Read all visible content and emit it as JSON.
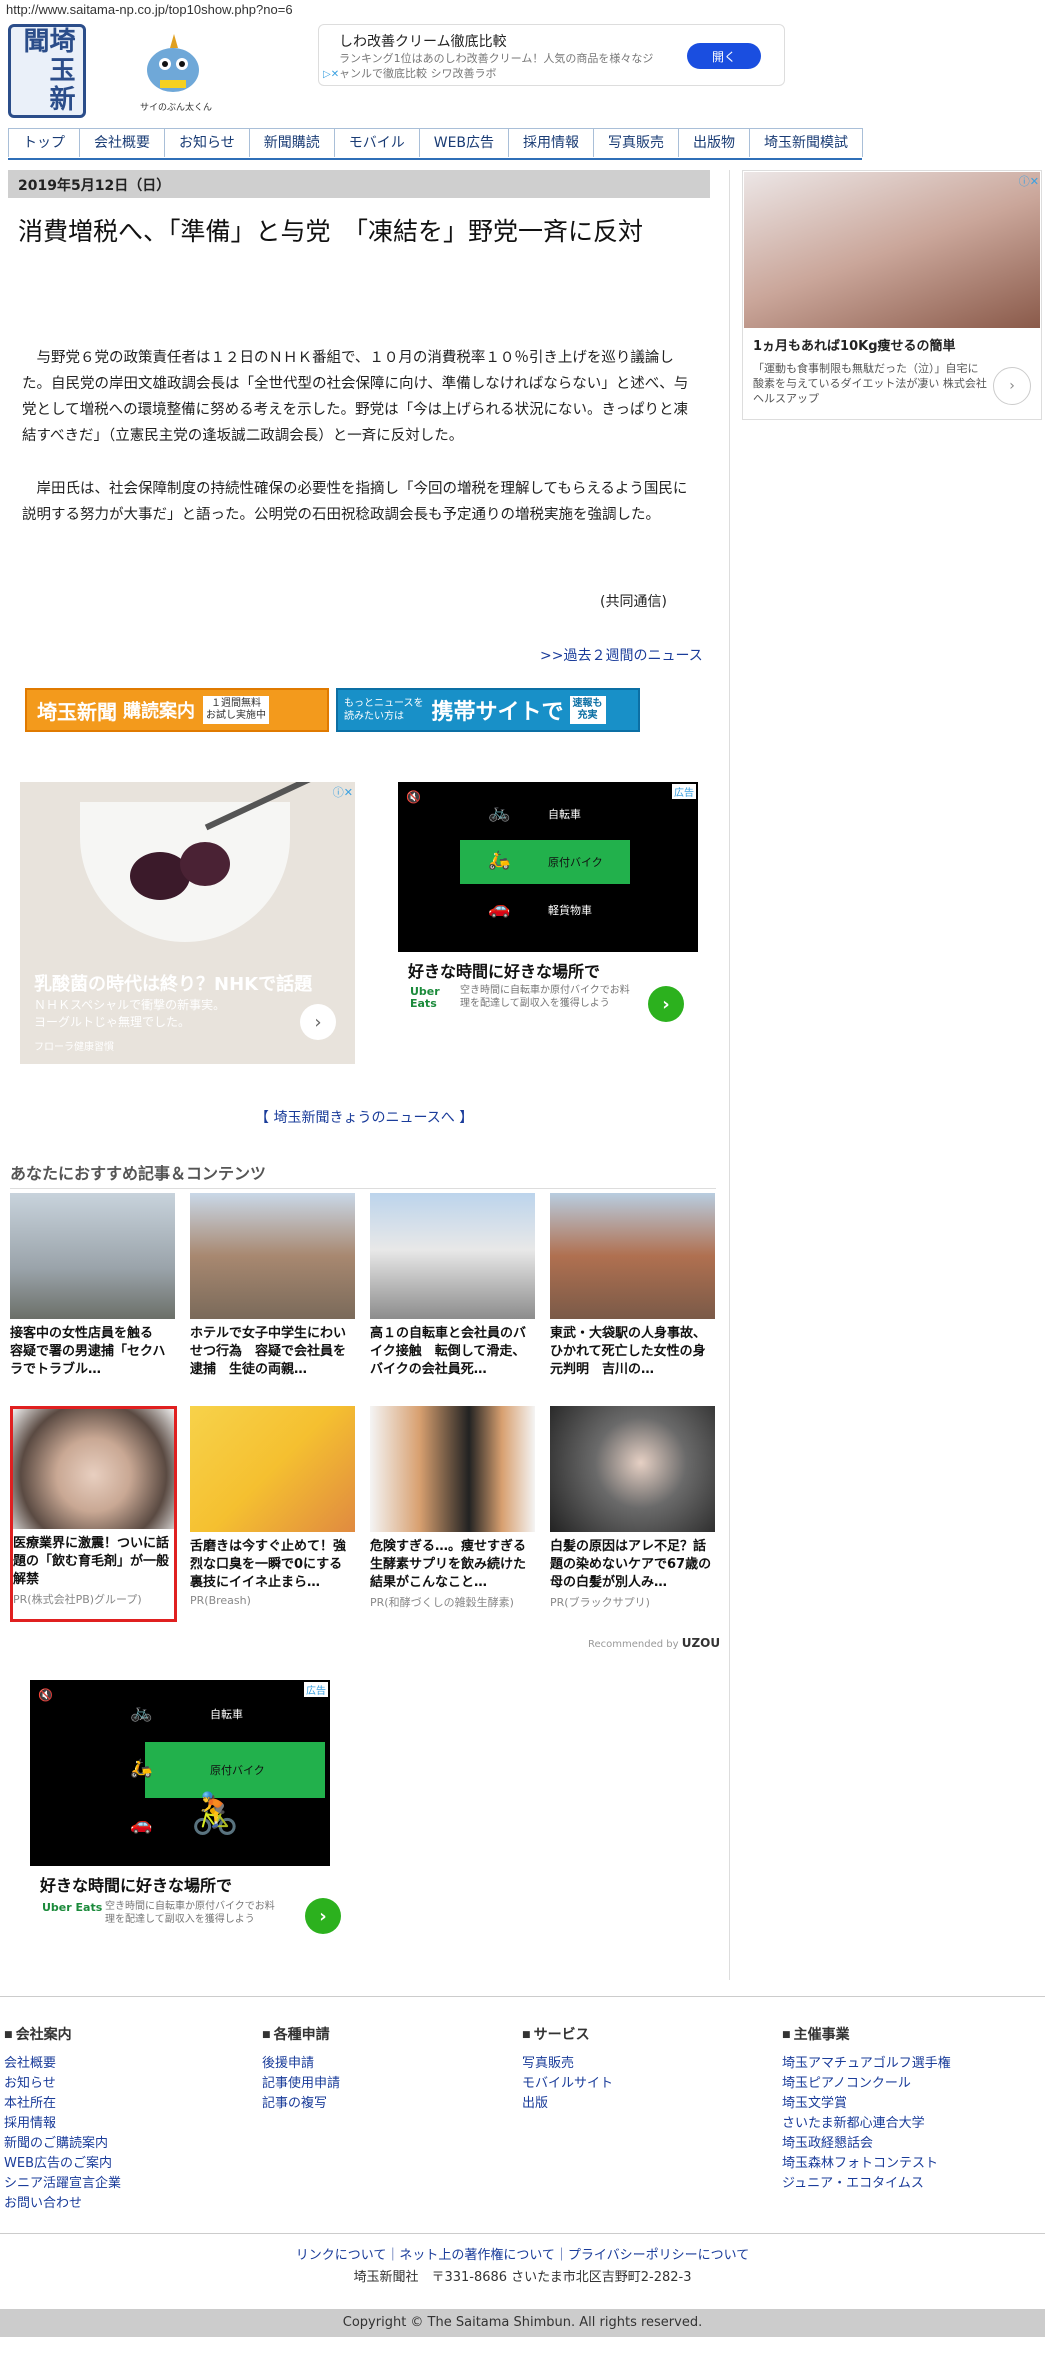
{
  "url": "http://www.saitama-np.co.jp/top10show.php?no=6",
  "logo": {
    "text": "埼玉新聞",
    "mascot_label": "サイのぶん太くん"
  },
  "top_ad": {
    "title": "しわ改善クリーム徹底比較",
    "desc": "ランキング1位はあのしわ改善クリーム！人気の商品を様々なジャンルで徹底比較 シワ改善ラボ",
    "button": "開く"
  },
  "nav": [
    "トップ",
    "会社概要",
    "お知らせ",
    "新聞購読",
    "モバイル",
    "WEB広告",
    "採用情報",
    "写真販売",
    "出版物",
    "埼玉新聞模試"
  ],
  "article": {
    "date": "2019年5月12日（日）",
    "title": "消費増税へ、「準備」と与党　「凍結を」野党一斉に反対",
    "p1": "与野党６党の政策責任者は１２日のＮＨＫ番組で、１０月の消費税率１０％引き上げを巡り議論した。自民党の岸田文雄政調会長は「全世代型の社会保障に向け、準備しなければならない」と述べ、与党として増税への環境整備に努める考えを示した。野党は「今は上げられる状況にない。きっぱりと凍結すべきだ」（立憲民主党の逢坂誠二政調会長）と一斉に反対した。",
    "p2": "岸田氏は、社会保障制度の持続性確保の必要性を指摘し「今回の増税を理解してもらえるよう国民に説明する努力が大事だ」と語った。公明党の石田祝稔政調会長も予定通りの増税実施を強調した。",
    "credit": "(共同通信)",
    "past_link": ">>過去２週間のニュース"
  },
  "banners": {
    "b1_logo": "埼玉新聞",
    "b1_text": "購読案内",
    "b1_badge": "１週間無料\nお試し実施中",
    "b2_small": "もっとニュースを\n読みたい方は",
    "b2_text": "携帯サイトで",
    "b2_badge": "速報も\n充実"
  },
  "ad_yogurt": {
    "headline": "乳酸菌の時代は終り？NHKで話題",
    "sub": "ＮＨＫスペシャルで衝撃の新事実。\nヨーグルトじゃ無理でした。",
    "advertiser": "フローラ健康習慣"
  },
  "ad_uber": {
    "row1": "自転車",
    "row2": "原付バイク",
    "row3": "軽貨物車",
    "headline": "好きな時間に好きな場所で",
    "logo": "Uber\nEats",
    "desc": "空き時間に自転車か原付バイクでお料理を配達して副収入を獲得しよう",
    "ad_label": "広告"
  },
  "today_link": "【 埼玉新聞きょうのニュースへ 】",
  "rec": {
    "heading": "あなたにおすすめ記事＆コンテンツ",
    "cards": [
      {
        "caption": "接客中の女性店員を触る　容疑で署の男逮捕「セクハラでトラブル…",
        "pr": ""
      },
      {
        "caption": "ホテルで女子中学生にわいせつ行為　容疑で会社員を逮捕　生徒の両親…",
        "pr": ""
      },
      {
        "caption": "高１の自転車と会社員のバイク接触　転倒して滑走、バイクの会社員死…",
        "pr": ""
      },
      {
        "caption": "東武・大袋駅の人身事故、ひかれて死亡した女性の身元判明　吉川の…",
        "pr": ""
      },
      {
        "caption": "医療業界に激震！ついに話題の「飲む育毛剤」が一般解禁",
        "pr": "PR(株式会社PB)グループ)"
      },
      {
        "caption": "舌磨きは今すぐ止めて！強烈な口臭を一瞬で0にする裏技にイイネ止まら…",
        "pr": "PR(Breash)"
      },
      {
        "caption": "危険すぎる…。痩せすぎる生酵素サプリを飲み続けた結果がこんなこと…",
        "pr": "PR(和酵づくしの雑穀生酵素)"
      },
      {
        "caption": "白髪の原因はアレ不足？話題の染めないケアで67歳の母の白髪が別人み…",
        "pr": "PR(ブラックサプリ)"
      }
    ],
    "recommended_by": "Recommended by",
    "uzou": "UZOU"
  },
  "side_ad": {
    "title": "1ヵ月もあれば10Kg痩せるの簡単",
    "desc": "「運動も食事制限も無駄だった（泣）」自宅に酸素を与えているダイエット法が凄い 株式会社ヘルスアップ"
  },
  "footer": {
    "cols": [
      {
        "heading": "会社案内",
        "links": [
          "会社概要",
          "お知らせ",
          "本社所在",
          "採用情報",
          "新聞のご購読案内",
          "WEB広告のご案内",
          "シニア活躍宣言企業",
          "お問い合わせ"
        ]
      },
      {
        "heading": "各種申請",
        "links": [
          "後援申請",
          "記事使用申請",
          "記事の複写"
        ]
      },
      {
        "heading": "サービス",
        "links": [
          "写真販売",
          "モバイルサイト",
          "出版"
        ]
      },
      {
        "heading": "主催事業",
        "links": [
          "埼玉アマチュアゴルフ選手権",
          "埼玉ピアノコンクール",
          "埼玉文学賞",
          "さいたま新都心連合大学",
          "埼玉政経懇話会",
          "埼玉森林フォトコンテスト",
          "ジュニア・エコタイムス"
        ]
      }
    ],
    "policy": "リンクについて｜ネット上の著作権について｜プライバシーポリシーについて",
    "address": "埼玉新聞社　〒331-8686 さいたま市北区吉野町2-282-3",
    "copyright": "Copyright © The Saitama Shimbun. All rights reserved."
  }
}
